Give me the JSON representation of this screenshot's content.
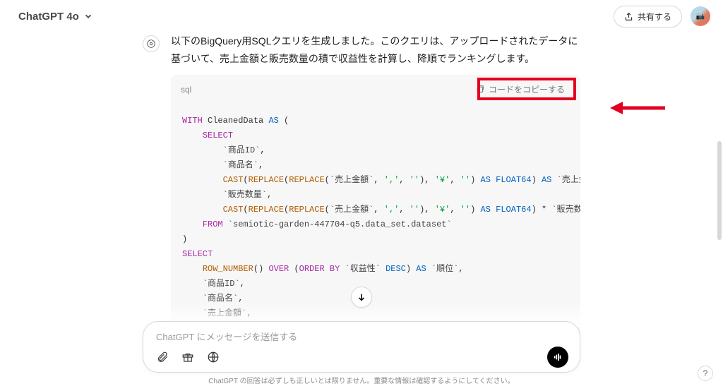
{
  "header": {
    "model": "ChatGPT 4o",
    "share_label": "共有する"
  },
  "message": {
    "intro": "以下のBigQuery用SQLクエリを生成しました。このクエリは、アップロードされたデータに基づいて、売上金額と販売数量の積で収益性を計算し、降順でランキングします。"
  },
  "code": {
    "language": "sql",
    "copy_label": "コードをコピーする",
    "tokens": {
      "with": "WITH",
      "as": "AS",
      "select": "SELECT",
      "from": "FROM",
      "cast": "CAST",
      "replace": "REPLACE",
      "float64": "FLOAT64",
      "row_number": "ROW_NUMBER",
      "over": "OVER",
      "order_by": "ORDER BY",
      "desc": "DESC"
    },
    "identifiers": {
      "cleaned_data": "CleanedData",
      "product_id": "`商品ID`",
      "product_name": "`商品名`",
      "sales_amount": "`売上金額`",
      "sales_qty": "`販売数量`",
      "profitability": "`収益性`",
      "profit_alias": "`収益",
      "rank": "`順位`",
      "table": "`semiotic-garden-447704-q5.data_set.dataset`"
    },
    "literals": {
      "comma": "','",
      "empty": "''",
      "yen": "'¥'"
    }
  },
  "composer": {
    "placeholder": "ChatGPT にメッセージを送信する"
  },
  "footer": {
    "disclaimer": "ChatGPT の回答は必ずしも正しいとは限りません。重要な情報は確認するようにしてください。",
    "help": "?"
  }
}
